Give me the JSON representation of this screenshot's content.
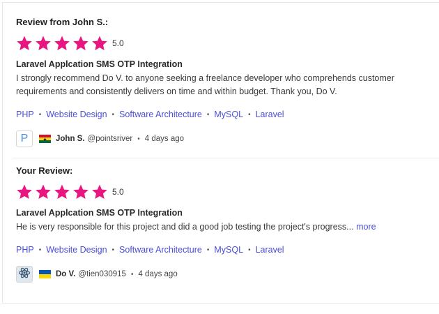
{
  "colors": {
    "star": "#e8167e",
    "link": "#4a4ed8"
  },
  "reviews": [
    {
      "heading": "Review from John S.:",
      "stars": 5,
      "rating": "5.0",
      "title": "Laravel Applcation SMS OTP Integration",
      "body": "I strongly recommend Do V. to anyone seeking a freelance developer who comprehends customer requirements and consistently delivers on time and within budget. Thank you, Do V.",
      "more": "",
      "tags": [
        "PHP",
        "Website Design",
        "Software Architecture",
        "MySQL",
        "Laravel"
      ],
      "author": {
        "avatar_letter": "P",
        "flag": "ghana-flag-icon",
        "name": "John S.",
        "handle": "@pointsriver",
        "time": "4 days ago"
      }
    },
    {
      "heading": "Your Review:",
      "stars": 5,
      "rating": "5.0",
      "title": "Laravel Applcation SMS OTP Integration",
      "body": "He is very responsible for this project and did a good job testing the project's progress...",
      "more": "more",
      "tags": [
        "PHP",
        "Website Design",
        "Software Architecture",
        "MySQL",
        "Laravel"
      ],
      "author": {
        "avatar_icon": "atom-icon",
        "flag": "ukraine-flag-icon",
        "name": "Do V.",
        "handle": "@tien030915",
        "time": "4 days ago"
      }
    }
  ]
}
